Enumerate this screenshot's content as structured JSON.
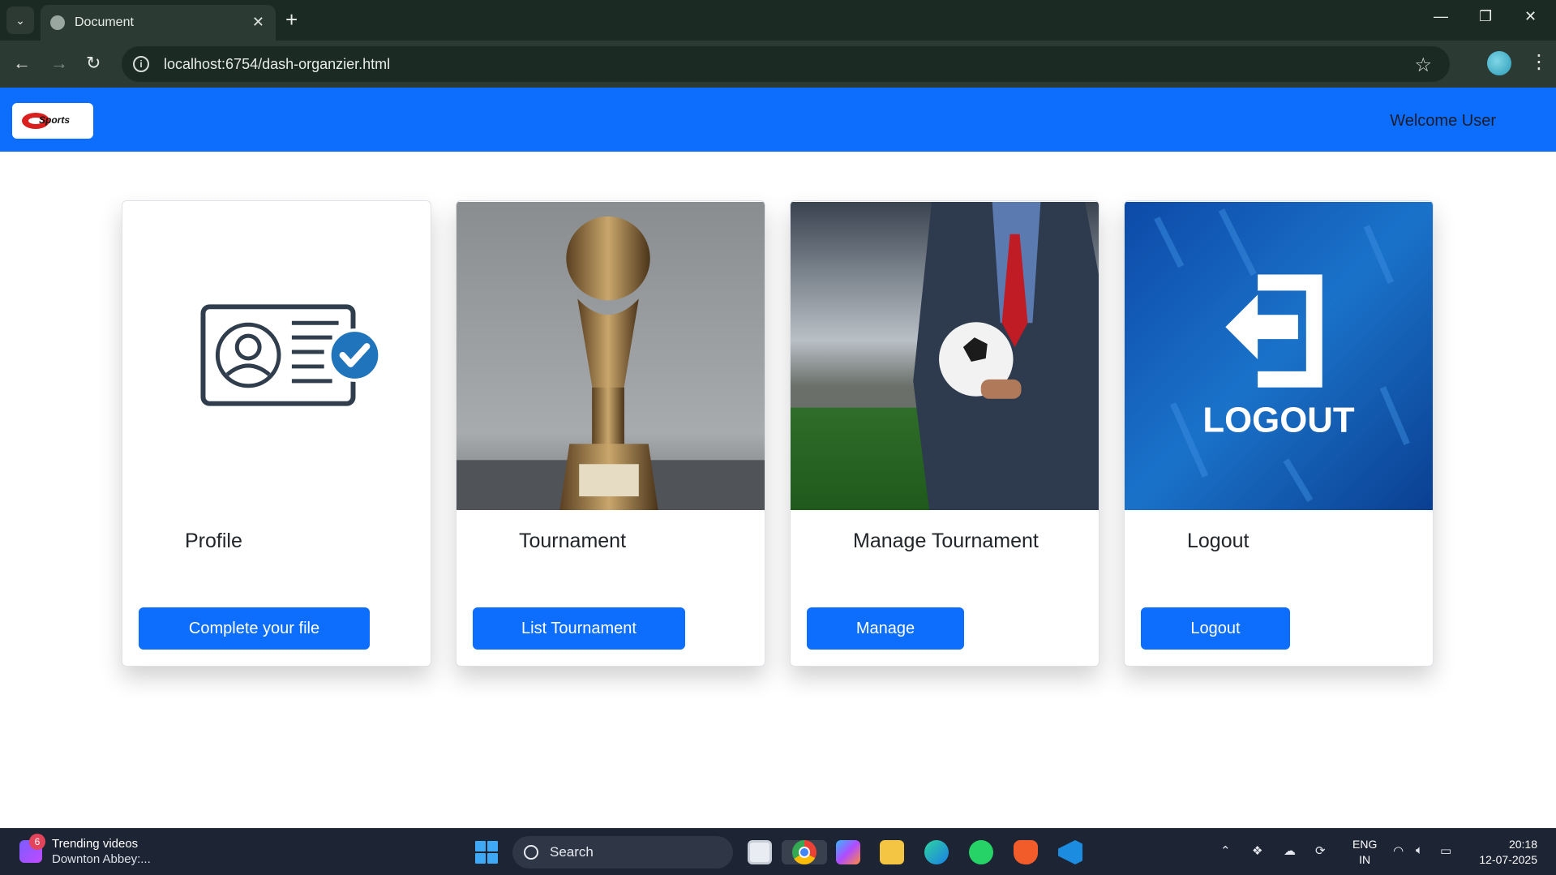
{
  "browser": {
    "tab_title": "Document",
    "tab_close": "✕",
    "new_tab": "+",
    "url": "localhost:6754/dash-organzier.html",
    "minimize": "—",
    "restore": "❐",
    "close": "✕"
  },
  "navbar": {
    "logo_text": "Sports",
    "welcome": "Welcome User",
    "color": "#0d6efd"
  },
  "cards": [
    {
      "title": "Profile",
      "button": "Complete your file",
      "image": "profile-id-card-icon"
    },
    {
      "title": "Tournament",
      "button": "List Tournament",
      "image": "trophy-photo"
    },
    {
      "title": "Manage Tournament",
      "button": "Manage",
      "image": "manager-with-ball-photo"
    },
    {
      "title": "Logout",
      "button": "Logout",
      "image": "logout-sign-image",
      "image_text": "LOGOUT"
    }
  ],
  "taskbar": {
    "widget_badge": "6",
    "widget_title": "Trending videos",
    "widget_sub": "Downton Abbey:...",
    "search_label": "Search",
    "lang_top": "ENG",
    "lang_bottom": "IN",
    "time": "20:18",
    "date": "12-07-2025"
  }
}
